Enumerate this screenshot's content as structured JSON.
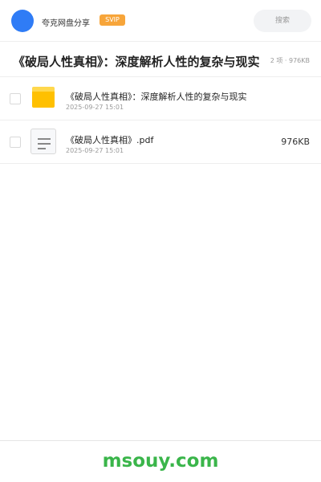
{
  "header": {
    "brand": "夸克网盘分享",
    "badge": "SVIP",
    "search_placeholder": "搜索"
  },
  "share": {
    "title": "《破局人性真相》：深度解析人性的复杂与现实",
    "meta": "2 项 · 976KB"
  },
  "files": [
    {
      "name": "《破局人性真相》：深度解析人性的复杂与现实",
      "date": "2025-09-27 15:01",
      "size": "",
      "icon": "folder-icon"
    },
    {
      "name": "《破局人性真相》.pdf",
      "date": "2025-09-27 15:01",
      "size": "976KB",
      "icon": "document-icon"
    }
  ],
  "footer": {
    "watermark": "msouy.com"
  },
  "colors": {
    "avatar": "#2f7cf6",
    "badge": "#f7a53a",
    "folder": "#ffc000",
    "watermark": "#3ab54a"
  }
}
